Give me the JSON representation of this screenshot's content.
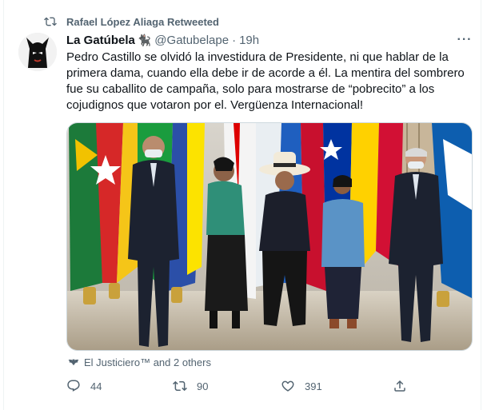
{
  "retweet": {
    "text": "Rafael López Aliaga Retweeted",
    "icon": "retweet-icon"
  },
  "author": {
    "name": "La Gatúbela",
    "name_emoji": "🐈‍⬛",
    "handle": "@Gatubelape",
    "separator": "·",
    "time": "19h"
  },
  "more_label": "···",
  "tweet_text": [
    "Pedro Castillo se olvidó la investidura de Presidente, ni que hablar de la",
    "primera dama, cuando ella debe ir de acorde a él. La mentira del sombrero",
    "fue su caballito de campaña, solo para mostrarse de “pobrecito” a los",
    "cojudignos que votaron por el. Vergüenza Internacional!"
  ],
  "liked_by": "El Justiciero™ and 2 others",
  "actions": {
    "reply_count": "44",
    "retweet_count": "90",
    "like_count": "391"
  },
  "colors": {
    "text": "#0f1419",
    "secondary": "#536471",
    "border": "#eff3f4"
  }
}
